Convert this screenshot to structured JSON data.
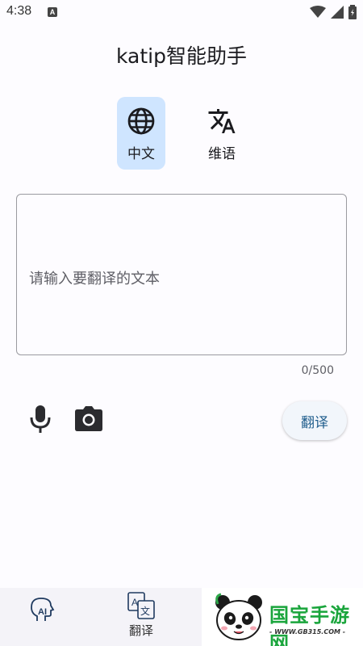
{
  "status_bar": {
    "time": "4:38",
    "notification_letter": "A"
  },
  "app": {
    "title": "katip智能助手"
  },
  "languages": [
    {
      "label": "中文",
      "icon": "globe-icon",
      "selected": true
    },
    {
      "label": "维语",
      "icon": "translate-icon",
      "selected": false
    }
  ],
  "input": {
    "placeholder": "请输入要翻译的文本",
    "value": "",
    "counter": "0/500"
  },
  "actions": {
    "mic_icon": "microphone-icon",
    "camera_icon": "camera-icon",
    "translate_label": "翻译"
  },
  "bottom_nav": {
    "ai_icon": "ai-head-icon",
    "translate_label": "翻译"
  },
  "watermark": {
    "brand": "国宝手游网",
    "site": "- WWW.GB315.COM -"
  },
  "colors": {
    "selected_bg": "#cfe5ff",
    "accent_text": "#1f5d8c",
    "watermark_green": "#1aa53c"
  }
}
